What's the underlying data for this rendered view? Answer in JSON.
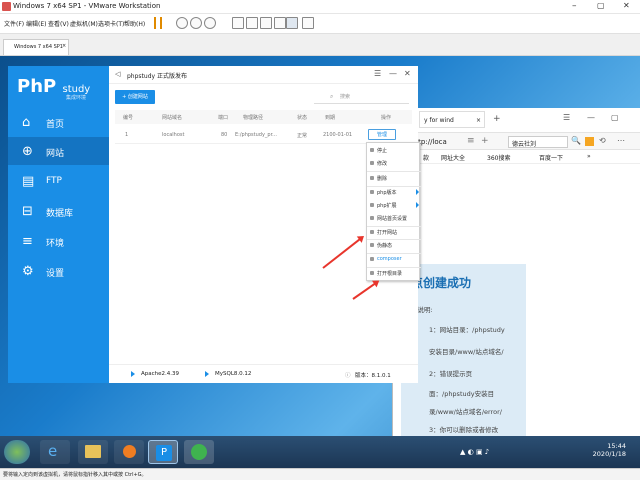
{
  "window": {
    "title": "Windows 7 x64 SP1 - VMware Workstation",
    "min": "–",
    "max": "▢",
    "close": "✕"
  },
  "menu": [
    "文件(F)",
    "编辑(E)",
    "查看(V)",
    "虚拟机(M)",
    "选项卡(T)",
    "帮助(H)"
  ],
  "vm_tab": {
    "label": "Windows 7 x64 SP1",
    "close": "×"
  },
  "phpstudy": {
    "logo": "PhP",
    "logo_word": "study",
    "logo_sub": "集成环境",
    "nav": [
      {
        "label": "首页",
        "icon": "home-icon"
      },
      {
        "label": "网站",
        "icon": "globe-icon"
      },
      {
        "label": "FTP",
        "icon": "server-icon"
      },
      {
        "label": "数据库",
        "icon": "database-icon"
      },
      {
        "label": "环境",
        "icon": "sliders-icon"
      },
      {
        "label": "设置",
        "icon": "gear-icon"
      }
    ],
    "title": "phpstudy 正式版发布",
    "create_button": "+ 创建网站",
    "search_placeholder": "搜索",
    "columns": [
      "编号",
      "网站域名",
      "端口",
      "物理路径",
      "状态",
      "到期",
      "操作"
    ],
    "row": {
      "id": "1",
      "domain": "localhost",
      "port": "80",
      "path": "E:/phpstudy_pr...",
      "status": "正常",
      "expire": "2100-01-01",
      "action": "管理"
    },
    "context_menu": [
      "停止",
      "修改",
      "删除",
      "php版本",
      "php扩展",
      "网站首页设置",
      "打开网站",
      "伪静态",
      "composer",
      "打开根目录"
    ],
    "footer": {
      "apache": "Apache2.4.39",
      "mysql": "MySQL8.0.12",
      "version": "版本：8.1.0.1"
    }
  },
  "browser": {
    "tab": "y for wind",
    "address": "http://loca",
    "search_hint": "德云社刘",
    "bookmarks": [
      "款",
      "网址大全",
      "360搜索",
      "百度一下"
    ],
    "more": "»",
    "heading": "点创建成功",
    "lines": [
      "录说明:",
      "1：网站目录：/phpstudy",
      "安装目录/www/站点域名/",
      "2：错误提示页",
      "面：/phpstudy安装目",
      "录/www/站点域名/error/",
      "3：你可以删除或者修改"
    ]
  },
  "taskbar": {
    "time": "15:44",
    "date": "2020/1/18"
  },
  "status": "要将输入定向到该虚拟机，请将鼠标指针移入其中或按 Ctrl+G。"
}
